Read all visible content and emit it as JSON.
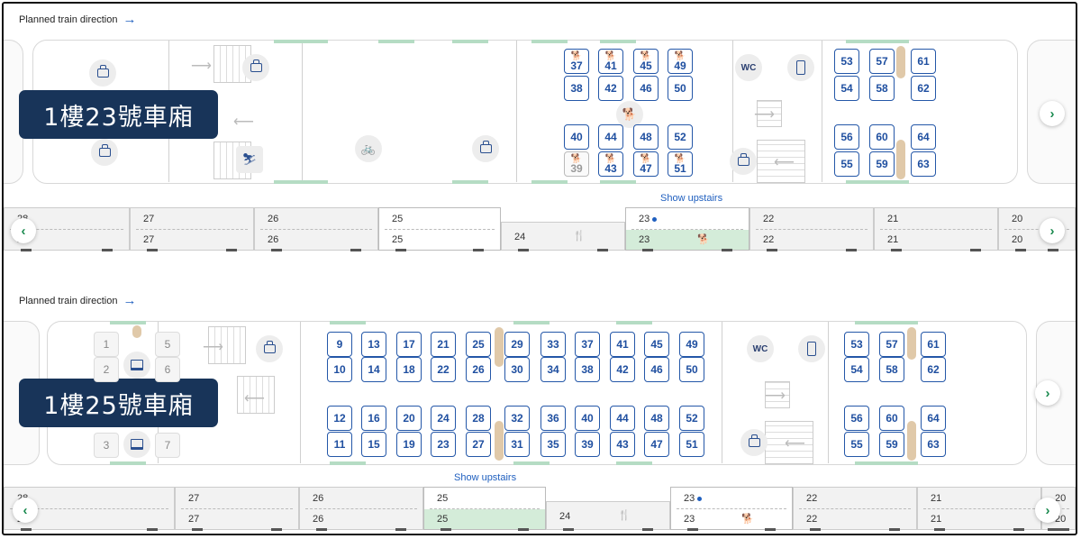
{
  "panels": [
    {
      "direction_label": "Planned train direction",
      "car_title": "1樓23號車廂",
      "show_upstairs": "Show upstairs",
      "seats": [
        {
          "n": "37",
          "dog": true
        },
        {
          "n": "41",
          "dog": true
        },
        {
          "n": "45",
          "dog": true
        },
        {
          "n": "49",
          "dog": true
        },
        {
          "n": "38"
        },
        {
          "n": "42"
        },
        {
          "n": "46"
        },
        {
          "n": "50"
        },
        {
          "n": "40"
        },
        {
          "n": "44"
        },
        {
          "n": "48"
        },
        {
          "n": "52"
        },
        {
          "n": "39",
          "dog": true,
          "taken": true
        },
        {
          "n": "43",
          "dog": true
        },
        {
          "n": "47",
          "dog": true
        },
        {
          "n": "51",
          "dog": true
        },
        {
          "n": "53"
        },
        {
          "n": "57"
        },
        {
          "n": "61"
        },
        {
          "n": "54"
        },
        {
          "n": "58"
        },
        {
          "n": "62"
        },
        {
          "n": "56"
        },
        {
          "n": "60"
        },
        {
          "n": "64"
        },
        {
          "n": "55"
        },
        {
          "n": "59"
        },
        {
          "n": "63"
        }
      ],
      "wc_label": "WC",
      "strip": [
        {
          "u": "28",
          "l": "28"
        },
        {
          "u": "27",
          "l": "27"
        },
        {
          "u": "26",
          "l": "26"
        },
        {
          "u": "25",
          "l": "25",
          "sel": true
        },
        {
          "m": "24",
          "dining": true
        },
        {
          "u": "23",
          "l": "23",
          "sel": true,
          "current": true,
          "dog": true
        },
        {
          "u": "22",
          "l": "22"
        },
        {
          "u": "21",
          "l": "21"
        },
        {
          "u": "20",
          "l": "20"
        }
      ]
    },
    {
      "direction_label": "Planned train direction",
      "car_title": "1樓25號車廂",
      "show_upstairs": "Show upstairs",
      "grey_seats": [
        "1",
        "5",
        "2",
        "6",
        "3",
        "7"
      ],
      "seats_top_a": [
        "9",
        "13",
        "17",
        "21",
        "25",
        "29",
        "33",
        "37",
        "41",
        "45",
        "49"
      ],
      "seats_top_b": [
        "10",
        "14",
        "18",
        "22",
        "26",
        "30",
        "34",
        "38",
        "42",
        "46",
        "50"
      ],
      "seats_bot_a": [
        "12",
        "16",
        "20",
        "24",
        "28",
        "32",
        "36",
        "40",
        "44",
        "48",
        "52"
      ],
      "seats_bot_b": [
        "11",
        "15",
        "19",
        "23",
        "27",
        "31",
        "35",
        "39",
        "43",
        "47",
        "51"
      ],
      "seats_right": [
        [
          "53",
          "57",
          "61"
        ],
        [
          "54",
          "58",
          "62"
        ],
        [
          "56",
          "60",
          "64"
        ],
        [
          "55",
          "59",
          "63"
        ]
      ],
      "wc_label": "WC",
      "strip": [
        {
          "u": "28",
          "l": "28"
        },
        {
          "u": "27",
          "l": "27"
        },
        {
          "u": "26",
          "l": "26"
        },
        {
          "u": "25",
          "l": "25",
          "sel": true,
          "current": true
        },
        {
          "m": "24",
          "dining": true
        },
        {
          "u": "23",
          "l": "23",
          "sel": true,
          "dog": true
        },
        {
          "u": "22",
          "l": "22"
        },
        {
          "u": "21",
          "l": "21"
        },
        {
          "u": "20",
          "l": "20"
        }
      ]
    }
  ],
  "icons": {
    "arrow_right": "→",
    "prev": "‹",
    "next": "›",
    "dog": "🐕",
    "bike": "🚲",
    "fork": "🍴",
    "ski": "⛷"
  }
}
